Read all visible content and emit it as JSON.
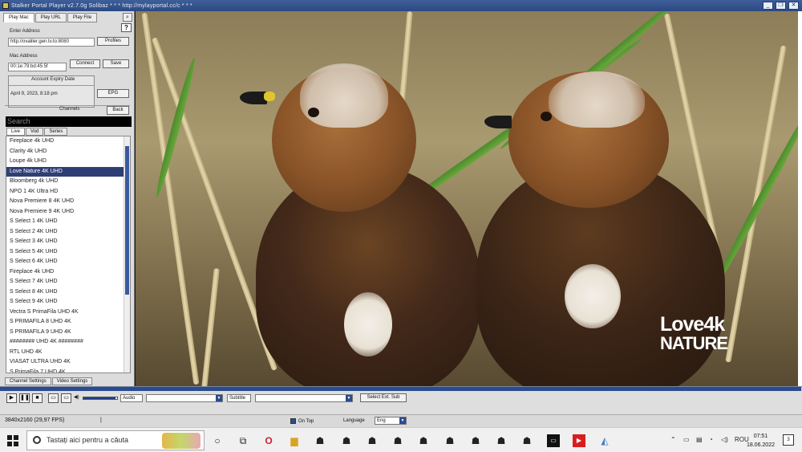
{
  "window": {
    "title": "Stalker Portal Player v2.7.0g Solibaz * * * http://mylayportal.cc/c * * *",
    "buttons": [
      "_",
      "❐",
      "✕"
    ]
  },
  "left_panel": {
    "top_tabs": [
      "Play Mac",
      "Play URL",
      "Play File"
    ],
    "help": "?",
    "portal_label": "Enter Address",
    "portal_value": "http://ovaliler.gen.tv.to:8080",
    "profiles_btn": "Profiles",
    "mac_label": "Mac Address",
    "mac_value": "00:1e:79:bd:45:5f",
    "connect_btn": "Connect",
    "save_btn": "Save",
    "expiry_label": "Account Expiry Date",
    "expiry_value": "April 9, 2023, 8:18 pm",
    "epg_btn": "EPG",
    "channels_label": "Channels",
    "back_btn": "Back",
    "search_placeholder": "Search",
    "sub_tabs": [
      "Live",
      "Vod",
      "Series"
    ],
    "channels": [
      "Fireplace 4k UHD",
      "Clarity 4k UHD",
      "Loupe 4k UHD",
      "Love Nature 4K UHD",
      "Bloomberg 4k UHD",
      "NPO 1 4K Ultra HD",
      "Nova Premiere 8 4K UHD",
      "Nova Premiere 9 4K UHD",
      "S Select 1 4K UHD",
      "S Select 2 4K UHD",
      "S Select 3 4K UHD",
      "S Select 5 4K UHD",
      "S Select 6 4K UHD",
      "Fireplace 4k UHD",
      "S Select 7 4K UHD",
      "S Select 8 4K UHD",
      "S Select 9 4K UHD",
      "Vectra S PrimaFila UHD 4K",
      "S PRIMAFILA 8 UHD 4K",
      "S PRIMAFILA 9 UHD 4K",
      "######## UHD 4K ########",
      "RTL UHD 4K",
      "VIASAT ULTRA UHD 4K",
      "S PrimaFila 7 UHD 4K"
    ],
    "selected_index": 3,
    "bottom_tabs": [
      "Channel Settings",
      "Video Settings"
    ]
  },
  "video": {
    "watermark_line1": "Love4k",
    "watermark_line2": "NATURE"
  },
  "controls": {
    "play": "▶",
    "pause": "❚❚",
    "stop": "■",
    "pip": "▭",
    "screen": "▭",
    "volume_icon": "◀)",
    "volume_level": 0.95,
    "seek_progress": 0.999,
    "audio_label": "Audio",
    "subtitle_label": "Subtitle",
    "select_ext_sub": "Select Ext. Sub"
  },
  "status": {
    "resolution": "3840x2160   (29,97 FPS)",
    "divider": "|",
    "on_top": "On Top",
    "language_label": "Language",
    "language_value": "Eng"
  },
  "taskbar": {
    "search_placeholder": "Tastați aici pentru a căuta",
    "tray_lang": "ROU",
    "time": "07:51",
    "date": "18.06.2022",
    "notif_count": "3"
  }
}
